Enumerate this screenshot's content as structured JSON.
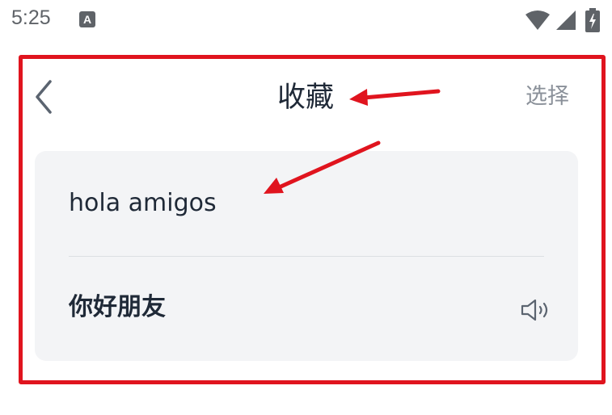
{
  "status_bar": {
    "time": "5:25",
    "notification_icon": "A"
  },
  "header": {
    "title": "收藏",
    "select_label": "选择"
  },
  "favorites": [
    {
      "source": "hola amigos",
      "translation": "你好朋友"
    }
  ],
  "colors": {
    "annotation": "#e0141e",
    "card_bg": "#f3f4f6",
    "text_primary": "#1f2937",
    "text_secondary": "#8a9099"
  },
  "icons": {
    "back": "chevron-left-icon",
    "speaker": "speaker-icon",
    "wifi": "wifi-icon",
    "signal": "signal-icon",
    "battery": "battery-charging-icon"
  }
}
